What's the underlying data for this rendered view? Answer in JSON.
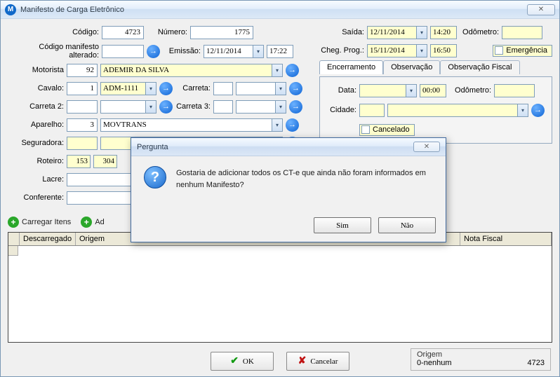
{
  "window": {
    "title": "Manifesto de Carga Eletrônico"
  },
  "labels": {
    "codigo": "Código:",
    "numero": "Número:",
    "codigo_alt": "Código manifesto alterado:",
    "emissao": "Emissão:",
    "motorista": "Motorista",
    "cavalo": "Cavalo:",
    "carreta": "Carreta:",
    "carreta2": "Carreta 2:",
    "carreta3": "Carreta 3:",
    "aparelho": "Aparelho:",
    "seguradora": "Seguradora:",
    "roteiro": "Roteiro:",
    "lacre": "Lacre:",
    "conferente": "Conferente:",
    "saida": "Saída:",
    "odometro": "Odômetro:",
    "cheg": "Cheg. Prog.:",
    "emergencia": "Emergência",
    "data": "Data:",
    "cidade": "Cidade:",
    "cancelado": "Cancelado"
  },
  "values": {
    "codigo": "4723",
    "numero": "1775",
    "codigo_alt": "",
    "emissao_date": "12/11/2014",
    "emissao_time": "17:22",
    "motorista_cod": "92",
    "motorista_nome": "ADEMIR DA SILVA",
    "cavalo_cod": "1",
    "cavalo_plate": "ADM-1111",
    "aparelho_cod": "3",
    "aparelho_nome": "MOVTRANS",
    "roteiro1": "153",
    "roteiro2": "304",
    "saida_date": "12/11/2014",
    "saida_time": "14:20",
    "cheg_date": "15/11/2014",
    "cheg_time": "16:50",
    "enc_time": "00:00"
  },
  "tabs": {
    "encerramento": "Encerramento",
    "observacao": "Observação",
    "obs_fiscal": "Observação Fiscal"
  },
  "actions": {
    "carregar": "Carregar Itens",
    "adicionar": "Ad"
  },
  "grid": {
    "col1": "Descarregado",
    "col2": "Origem",
    "col3": "Nota Fiscal"
  },
  "footer": {
    "ok": "OK",
    "cancel": "Cancelar"
  },
  "origin": {
    "label": "Origem",
    "text": "0-nenhum",
    "num": "4723"
  },
  "dialog": {
    "title": "Pergunta",
    "message": "Gostaria de adicionar todos os CT-e que ainda não foram informados em nenhum Manifesto?",
    "yes": "Sim",
    "no": "Não"
  }
}
